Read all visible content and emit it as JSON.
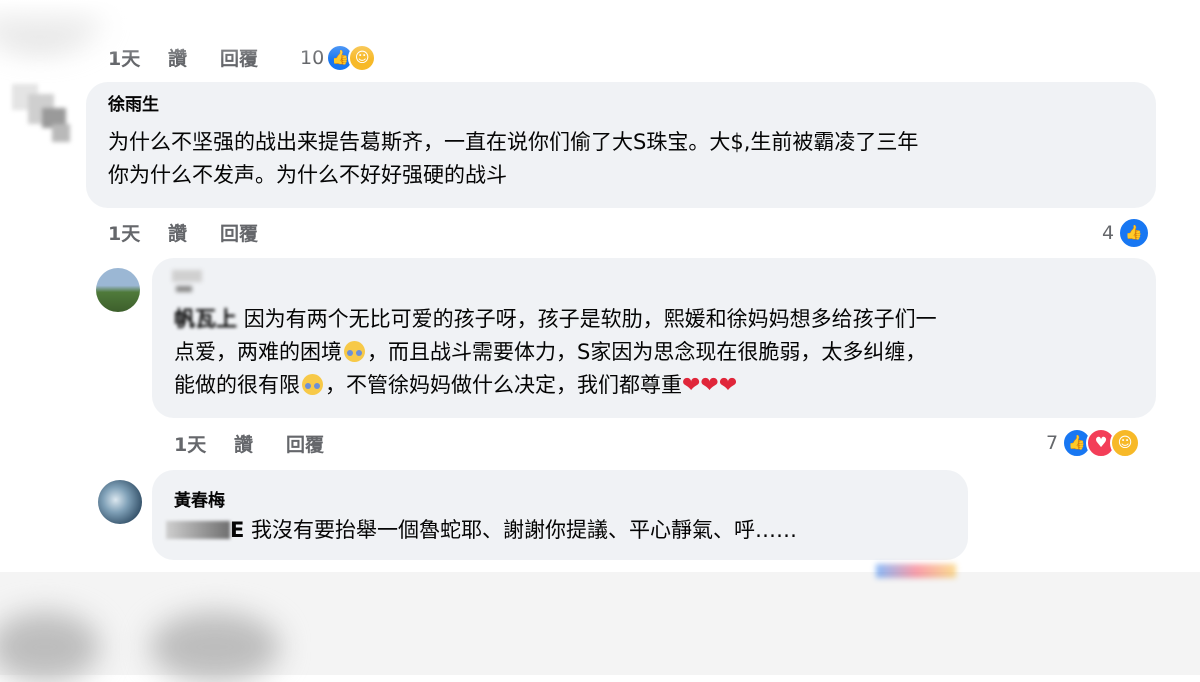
{
  "comments": [
    {
      "id": "c0",
      "actions": {
        "time": "1天",
        "like": "讚",
        "reply": "回覆"
      },
      "reaction_count": "10"
    },
    {
      "id": "c1",
      "author": "徐雨生",
      "text_line1": "为什么不坚强的战出来提告葛斯齐，一直在说你们偷了大S珠宝。大$,生前被霸凌了三年",
      "text_line2": "你为什么不发声。为什么不好好强硬的战斗",
      "actions": {
        "time": "1天",
        "like": "讚",
        "reply": "回覆"
      },
      "reaction_count": "4"
    },
    {
      "id": "c2",
      "author": "",
      "mention": "帆瓦上",
      "text_line1": "因为有两个无比可爱的孩子呀，孩子是软肋，熙媛和徐妈妈想多给孩子们一",
      "text_line2a": "点爱，两难的困境",
      "text_line2b": "，而且战斗需要体力，S家因为思念现在很脆弱，太多纠缠，",
      "text_line3a": "能做的很有限",
      "text_line3b": "，不管徐妈妈做什么决定，我们都尊重",
      "hearts": "❤❤❤",
      "actions": {
        "time": "1天",
        "like": "讚",
        "reply": "回覆"
      },
      "reaction_count": "7"
    },
    {
      "id": "c3",
      "author": "黃春梅",
      "mention": "E",
      "text": "我沒有要抬舉一個魯蛇耶、謝謝你提議、平心靜氣、呼……"
    }
  ],
  "icons": {
    "like": "like-icon",
    "love": "love-icon",
    "care": "care-icon"
  },
  "colors": {
    "bubble": "#f0f2f5",
    "meta": "#65676b",
    "like": "#1877f2",
    "love": "#f33e58",
    "care": "#f7b928"
  }
}
